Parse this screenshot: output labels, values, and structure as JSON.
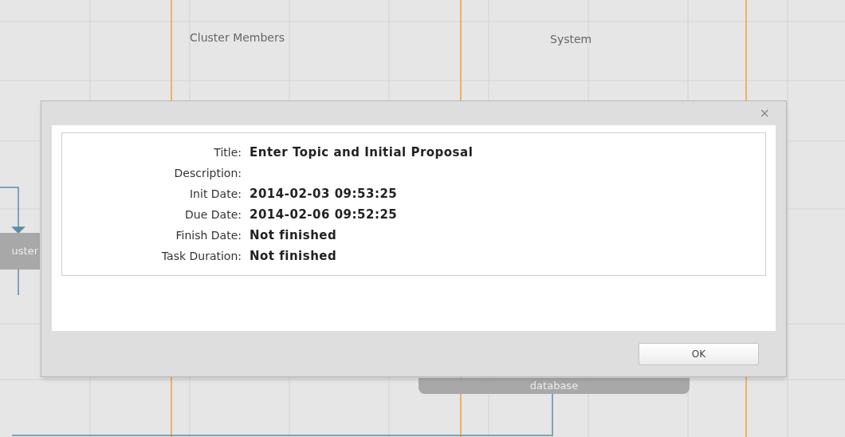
{
  "canvas": {
    "lanes": [
      "Cluster Members",
      "System"
    ],
    "nodes": [
      {
        "label": "uster"
      },
      {
        "label": "database"
      }
    ]
  },
  "dialog": {
    "close": "×",
    "fields": [
      {
        "label": "Title:",
        "value": "Enter Topic and Initial Proposal"
      },
      {
        "label": "Description:"
      },
      {
        "label": "Init Date:",
        "value": "2014-02-03 09:53:25"
      },
      {
        "label": "Due Date:",
        "value": "2014-02-06 09:52:25"
      },
      {
        "label": "Finish Date:",
        "value": "Not finished"
      },
      {
        "label": "Task Duration:",
        "value": "Not finished"
      }
    ],
    "buttons": [
      "OK"
    ]
  }
}
